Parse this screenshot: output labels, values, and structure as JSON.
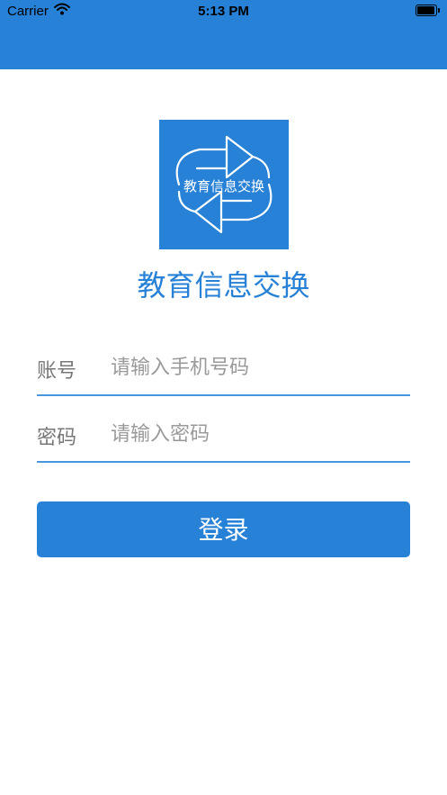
{
  "status_bar": {
    "carrier": "Carrier",
    "time": "5:13 PM"
  },
  "logo": {
    "text": "教育信息交换",
    "icon": "exchange-arrows-icon"
  },
  "app_title": "教育信息交换",
  "account": {
    "label": "账号",
    "placeholder": "请输入手机号码",
    "value": ""
  },
  "password": {
    "label": "密码",
    "placeholder": "请输入密码",
    "value": ""
  },
  "login": {
    "label": "登录"
  },
  "colors": {
    "primary": "#2781d6",
    "underline": "#4a96dd",
    "label": "#777777",
    "placeholder": "#9a9a9a"
  }
}
